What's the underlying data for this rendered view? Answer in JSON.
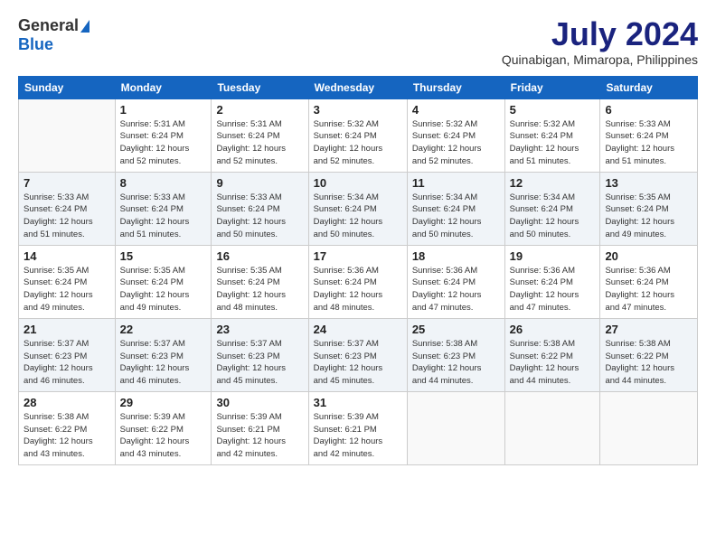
{
  "header": {
    "logo_general": "General",
    "logo_blue": "Blue",
    "month_title": "July 2024",
    "location": "Quinabigan, Mimaropa, Philippines"
  },
  "columns": [
    "Sunday",
    "Monday",
    "Tuesday",
    "Wednesday",
    "Thursday",
    "Friday",
    "Saturday"
  ],
  "weeks": [
    [
      {
        "day": "",
        "info": ""
      },
      {
        "day": "1",
        "info": "Sunrise: 5:31 AM\nSunset: 6:24 PM\nDaylight: 12 hours\nand 52 minutes."
      },
      {
        "day": "2",
        "info": "Sunrise: 5:31 AM\nSunset: 6:24 PM\nDaylight: 12 hours\nand 52 minutes."
      },
      {
        "day": "3",
        "info": "Sunrise: 5:32 AM\nSunset: 6:24 PM\nDaylight: 12 hours\nand 52 minutes."
      },
      {
        "day": "4",
        "info": "Sunrise: 5:32 AM\nSunset: 6:24 PM\nDaylight: 12 hours\nand 52 minutes."
      },
      {
        "day": "5",
        "info": "Sunrise: 5:32 AM\nSunset: 6:24 PM\nDaylight: 12 hours\nand 51 minutes."
      },
      {
        "day": "6",
        "info": "Sunrise: 5:33 AM\nSunset: 6:24 PM\nDaylight: 12 hours\nand 51 minutes."
      }
    ],
    [
      {
        "day": "7",
        "info": "Sunrise: 5:33 AM\nSunset: 6:24 PM\nDaylight: 12 hours\nand 51 minutes."
      },
      {
        "day": "8",
        "info": "Sunrise: 5:33 AM\nSunset: 6:24 PM\nDaylight: 12 hours\nand 51 minutes."
      },
      {
        "day": "9",
        "info": "Sunrise: 5:33 AM\nSunset: 6:24 PM\nDaylight: 12 hours\nand 50 minutes."
      },
      {
        "day": "10",
        "info": "Sunrise: 5:34 AM\nSunset: 6:24 PM\nDaylight: 12 hours\nand 50 minutes."
      },
      {
        "day": "11",
        "info": "Sunrise: 5:34 AM\nSunset: 6:24 PM\nDaylight: 12 hours\nand 50 minutes."
      },
      {
        "day": "12",
        "info": "Sunrise: 5:34 AM\nSunset: 6:24 PM\nDaylight: 12 hours\nand 50 minutes."
      },
      {
        "day": "13",
        "info": "Sunrise: 5:35 AM\nSunset: 6:24 PM\nDaylight: 12 hours\nand 49 minutes."
      }
    ],
    [
      {
        "day": "14",
        "info": "Sunrise: 5:35 AM\nSunset: 6:24 PM\nDaylight: 12 hours\nand 49 minutes."
      },
      {
        "day": "15",
        "info": "Sunrise: 5:35 AM\nSunset: 6:24 PM\nDaylight: 12 hours\nand 49 minutes."
      },
      {
        "day": "16",
        "info": "Sunrise: 5:35 AM\nSunset: 6:24 PM\nDaylight: 12 hours\nand 48 minutes."
      },
      {
        "day": "17",
        "info": "Sunrise: 5:36 AM\nSunset: 6:24 PM\nDaylight: 12 hours\nand 48 minutes."
      },
      {
        "day": "18",
        "info": "Sunrise: 5:36 AM\nSunset: 6:24 PM\nDaylight: 12 hours\nand 47 minutes."
      },
      {
        "day": "19",
        "info": "Sunrise: 5:36 AM\nSunset: 6:24 PM\nDaylight: 12 hours\nand 47 minutes."
      },
      {
        "day": "20",
        "info": "Sunrise: 5:36 AM\nSunset: 6:24 PM\nDaylight: 12 hours\nand 47 minutes."
      }
    ],
    [
      {
        "day": "21",
        "info": "Sunrise: 5:37 AM\nSunset: 6:23 PM\nDaylight: 12 hours\nand 46 minutes."
      },
      {
        "day": "22",
        "info": "Sunrise: 5:37 AM\nSunset: 6:23 PM\nDaylight: 12 hours\nand 46 minutes."
      },
      {
        "day": "23",
        "info": "Sunrise: 5:37 AM\nSunset: 6:23 PM\nDaylight: 12 hours\nand 45 minutes."
      },
      {
        "day": "24",
        "info": "Sunrise: 5:37 AM\nSunset: 6:23 PM\nDaylight: 12 hours\nand 45 minutes."
      },
      {
        "day": "25",
        "info": "Sunrise: 5:38 AM\nSunset: 6:23 PM\nDaylight: 12 hours\nand 44 minutes."
      },
      {
        "day": "26",
        "info": "Sunrise: 5:38 AM\nSunset: 6:22 PM\nDaylight: 12 hours\nand 44 minutes."
      },
      {
        "day": "27",
        "info": "Sunrise: 5:38 AM\nSunset: 6:22 PM\nDaylight: 12 hours\nand 44 minutes."
      }
    ],
    [
      {
        "day": "28",
        "info": "Sunrise: 5:38 AM\nSunset: 6:22 PM\nDaylight: 12 hours\nand 43 minutes."
      },
      {
        "day": "29",
        "info": "Sunrise: 5:39 AM\nSunset: 6:22 PM\nDaylight: 12 hours\nand 43 minutes."
      },
      {
        "day": "30",
        "info": "Sunrise: 5:39 AM\nSunset: 6:21 PM\nDaylight: 12 hours\nand 42 minutes."
      },
      {
        "day": "31",
        "info": "Sunrise: 5:39 AM\nSunset: 6:21 PM\nDaylight: 12 hours\nand 42 minutes."
      },
      {
        "day": "",
        "info": ""
      },
      {
        "day": "",
        "info": ""
      },
      {
        "day": "",
        "info": ""
      }
    ]
  ]
}
